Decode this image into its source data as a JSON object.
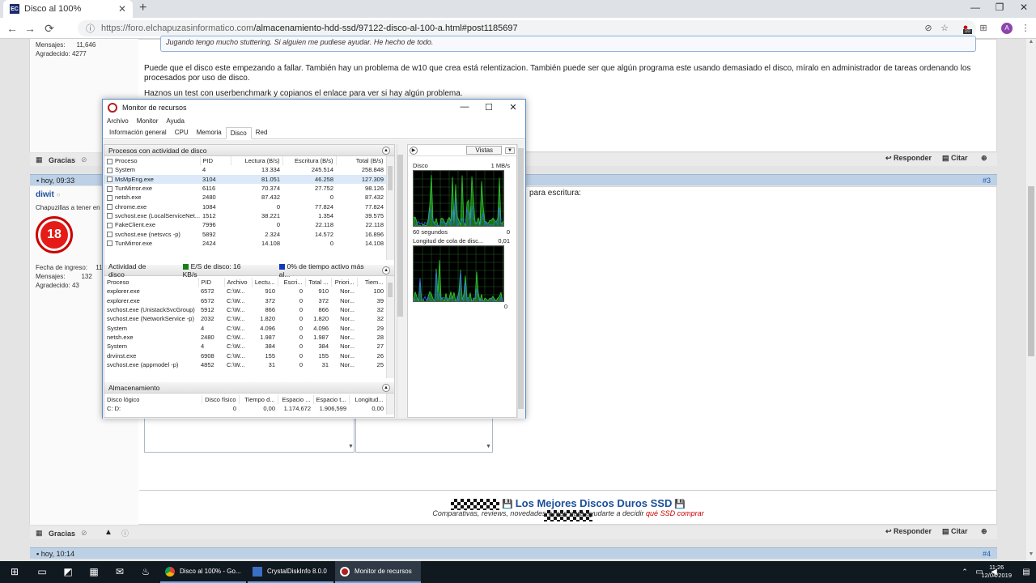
{
  "browser": {
    "tab_title": "Disco al 100%",
    "url_host": "https://foro.elchapuzasinformatico.com",
    "url_path": "/almacenamiento-hdd-ssd/97122-disco-al-100-a.html#post1185697",
    "profile_letter": "A",
    "ext_badge": "10"
  },
  "forum": {
    "post1": {
      "user_stats": {
        "mensajes_label": "Mensajes:",
        "mensajes": "11,646",
        "agradecido_label": "Agradecido:",
        "agradecido": "4277"
      },
      "quote": "Jugando tengo mucho stuttering. Si alguien me pudiese ayudar. He hecho de todo.",
      "para1": "Puede que el disco este empezando a fallar. También hay un problema de w10 que crea está relentizacion. También puede ser que algún programa este usando demasiado el disco, míralo en administrador de tareas ordenando los procesados por uso de disco.",
      "para2": "Haznos un test con userbenchmark y copianos el enlace para ver si hay algún problema.",
      "gracias": "Gracias",
      "responder": "Responder",
      "citar": "Citar"
    },
    "post2": {
      "time": "hoy, 09:33",
      "num": "#3",
      "username": "diwit",
      "user_title": "Chapuzillas a tener en cu",
      "avatar_text": "18",
      "fecha_label": "Fecha de ingreso:",
      "fecha": "11 di",
      "mensajes_label": "Mensajes:",
      "mensajes": "132",
      "agradecido_label": "Agradecido:",
      "agradecido": "43",
      "text_fragment": "para escritura:",
      "gracias": "Gracias",
      "responder": "Responder",
      "citar": "Citar"
    },
    "signature": {
      "title": "Los Mejores Discos Duros SSD",
      "sub_pre": "Comparativas, reviews, novedades y mas para ayudarte a decidir ",
      "sub_link": "qué SSD comprar"
    },
    "post3": {
      "time": "hoy, 10:14",
      "num": "#4"
    }
  },
  "resmon": {
    "title": "Monitor de recursos",
    "menu": [
      "Archivo",
      "Monitor",
      "Ayuda"
    ],
    "tabs": [
      "Información general",
      "CPU",
      "Memoria",
      "Disco",
      "Red"
    ],
    "active_tab": "Disco",
    "procs": {
      "title": "Procesos con actividad de disco",
      "columns": [
        "Proceso",
        "PID",
        "Lectura (B/s)",
        "Escritura (B/s)",
        "Total (B/s)"
      ],
      "rows": [
        [
          "System",
          "4",
          "13.334",
          "245.514",
          "258.848"
        ],
        [
          "MsMpEng.exe",
          "3104",
          "81.051",
          "46.258",
          "127.309"
        ],
        [
          "TunMirror.exe",
          "6116",
          "70.374",
          "27.752",
          "98.126"
        ],
        [
          "netsh.exe",
          "2480",
          "87.432",
          "0",
          "87.432"
        ],
        [
          "chrome.exe",
          "1084",
          "0",
          "77.824",
          "77.824"
        ],
        [
          "svchost.exe (LocalServiceNet...",
          "1512",
          "38.221",
          "1.354",
          "39.575"
        ],
        [
          "FakeClient.exe",
          "7996",
          "0",
          "22.118",
          "22.118"
        ],
        [
          "svchost.exe (netsvcs -p)",
          "5892",
          "2.324",
          "14.572",
          "16.896"
        ],
        [
          "TunMirror.exe",
          "2424",
          "14.108",
          "0",
          "14.108"
        ]
      ],
      "selected_row": 1
    },
    "activity": {
      "title": "Actividad de disco",
      "legend_io": "E/S de disco: 16 KB/s",
      "legend_active": "0% de tiempo activo más al...",
      "columns": [
        "Proceso",
        "PID",
        "Archivo",
        "Lectu...",
        "Escri...",
        "Total ...",
        "Priori...",
        "Tiem..."
      ],
      "rows": [
        [
          "explorer.exe",
          "6572",
          "C:\\W...",
          "910",
          "0",
          "910",
          "Nor...",
          "100"
        ],
        [
          "explorer.exe",
          "6572",
          "C:\\W...",
          "372",
          "0",
          "372",
          "Nor...",
          "39"
        ],
        [
          "svchost.exe (UnistackSvcGroup)",
          "5912",
          "C:\\W...",
          "866",
          "0",
          "866",
          "Nor...",
          "32"
        ],
        [
          "svchost.exe (NetworkService -p)",
          "2032",
          "C:\\W...",
          "1.820",
          "0",
          "1.820",
          "Nor...",
          "32"
        ],
        [
          "System",
          "4",
          "C:\\W...",
          "4.096",
          "0",
          "4.096",
          "Nor...",
          "29"
        ],
        [
          "netsh.exe",
          "2480",
          "C:\\W...",
          "1.987",
          "0",
          "1.987",
          "Nor...",
          "28"
        ],
        [
          "System",
          "4",
          "C:\\W...",
          "384",
          "0",
          "384",
          "Nor...",
          "27"
        ],
        [
          "drvinst.exe",
          "6908",
          "C:\\W...",
          "155",
          "0",
          "155",
          "Nor...",
          "26"
        ],
        [
          "svchost.exe (appmodel -p)",
          "4852",
          "C:\\W...",
          "31",
          "0",
          "31",
          "Nor...",
          "25"
        ]
      ]
    },
    "storage": {
      "title": "Almacenamiento",
      "columns": [
        "Disco lógico",
        "Disco físico",
        "Tiempo d...",
        "Espacio ...",
        "Espacio t...",
        "Longitud..."
      ],
      "rows": [
        [
          "C: D:",
          "0",
          "",
          "0,00",
          "1.174,672",
          "1.906,599",
          "0,00"
        ]
      ]
    },
    "graphs": {
      "views_label": "Vistas",
      "disk_label": "Disco",
      "disk_scale": "1 MB/s",
      "seconds_label": "60 segundos",
      "disk_min": "0",
      "queue_label": "Longitud de cola de disc...",
      "queue_scale": "0,01",
      "queue_min": "0"
    }
  },
  "taskbar": {
    "apps": [
      {
        "label": "Disco al 100% - Go..."
      },
      {
        "label": "CrystalDiskInfo 8.0.0"
      },
      {
        "label": "Monitor de recursos"
      }
    ],
    "time": "11:26",
    "date": "12/04/2019"
  },
  "colors": {
    "graph_green": "#2ecc2e",
    "graph_blue": "#2f6df0",
    "accent": "#1a4f9a"
  }
}
